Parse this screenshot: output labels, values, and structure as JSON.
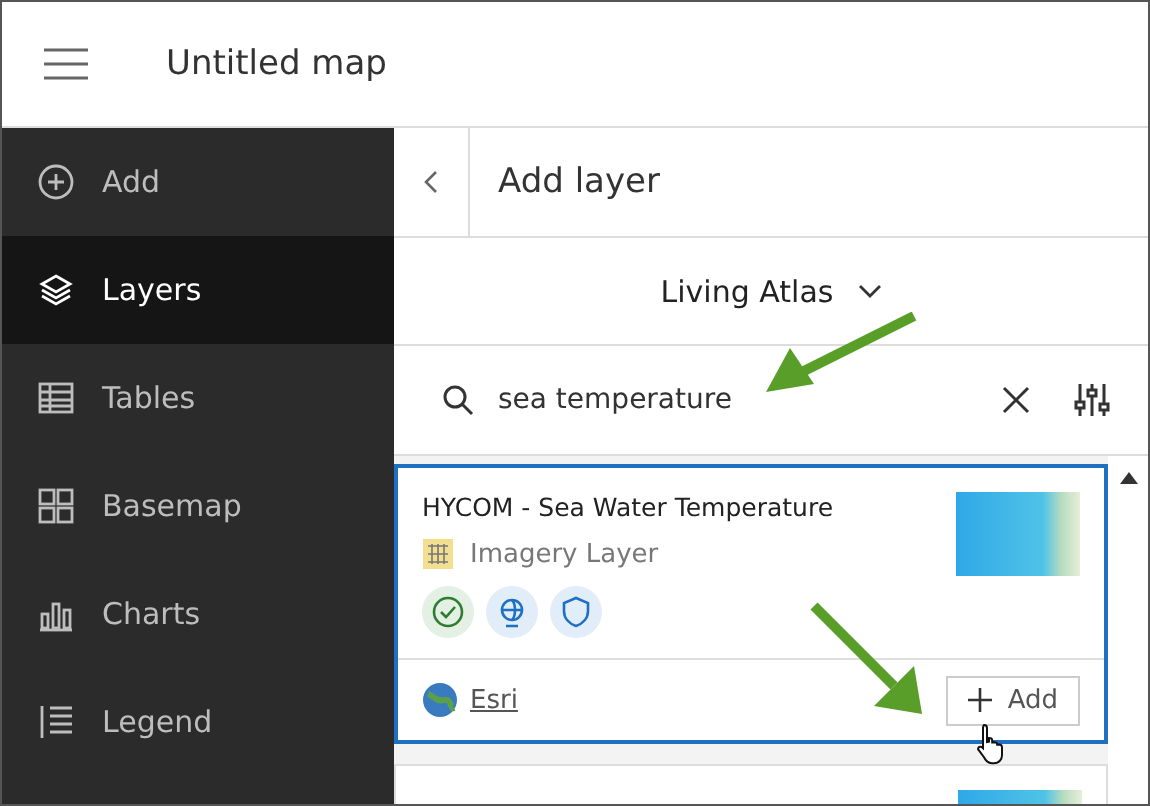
{
  "header": {
    "title": "Untitled map"
  },
  "sidebar": {
    "items": [
      {
        "label": "Add",
        "selected": false
      },
      {
        "label": "Layers",
        "selected": true
      },
      {
        "label": "Tables",
        "selected": false
      },
      {
        "label": "Basemap",
        "selected": false
      },
      {
        "label": "Charts",
        "selected": false
      },
      {
        "label": "Legend",
        "selected": false
      }
    ]
  },
  "panel": {
    "title": "Add layer",
    "source": "Living Atlas",
    "search": {
      "value": "sea temperature"
    },
    "results": [
      {
        "title": "HYCOM - Sea Water Temperature",
        "type": "Imagery Layer",
        "owner": "Esri",
        "action": "Add",
        "selected": true
      },
      {
        "selected": false
      }
    ]
  }
}
